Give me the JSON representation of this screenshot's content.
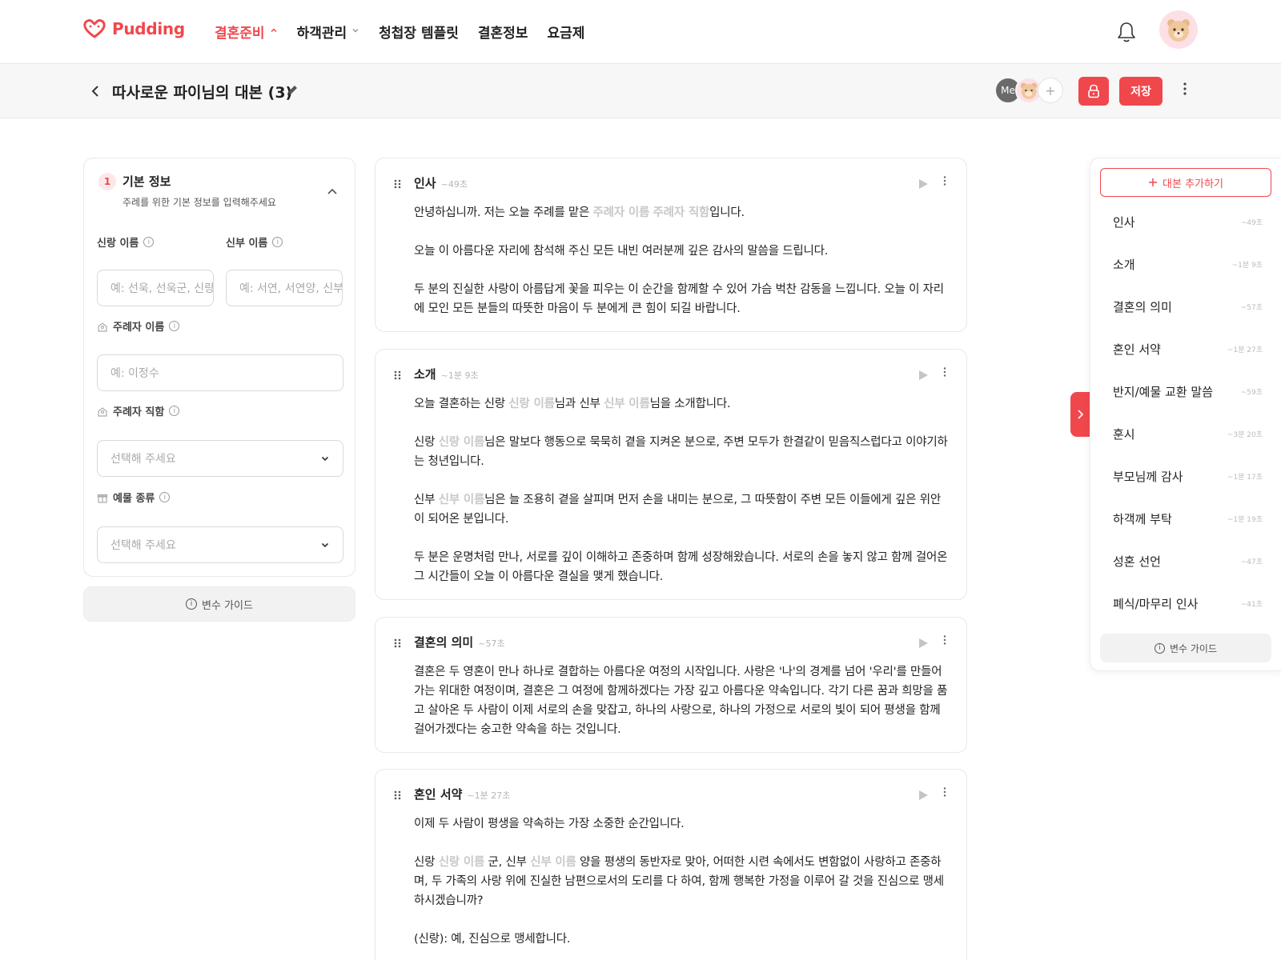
{
  "brand": {
    "name": "Pudding",
    "accent": "#f0474d"
  },
  "nav": {
    "items": [
      {
        "label": "결혼준비",
        "active": true,
        "chevron": "^"
      },
      {
        "label": "하객관리",
        "active": false,
        "chevron": "⌄"
      },
      {
        "label": "청첩장 템플릿",
        "active": false
      },
      {
        "label": "결혼정보",
        "active": false
      },
      {
        "label": "요금제",
        "active": false
      }
    ]
  },
  "header": {
    "title": "따사로운 파이님의 대본 (3)",
    "collaborator_me": "Me",
    "save_label": "저장"
  },
  "form": {
    "step_number": "1",
    "step_title": "기본 정보",
    "step_subtitle": "주례를 위한 기본 정보를 입력해주세요",
    "groom_label": "신랑 이름",
    "groom_placeholder": "예: 선욱, 선욱군, 신랑",
    "bride_label": "신부 이름",
    "bride_placeholder": "예: 서연, 서연양, 신부",
    "officiant_label": "주례자 이름",
    "officiant_placeholder": "예: 이정수",
    "officiant_title_label": "주례자 직함",
    "officiant_title_placeholder": "선택해 주세요",
    "gift_label": "예물 종류",
    "gift_placeholder": "선택해 주세요",
    "guide_label": "변수 가이드"
  },
  "cards": [
    {
      "title": "인사",
      "duration": "~49초",
      "paragraphs": [
        [
          {
            "t": "안녕하십니까. 저는 오늘 주례를 맡은 "
          },
          {
            "t": "주례자 이름",
            "v": true
          },
          {
            "t": " "
          },
          {
            "t": "주례자 직함",
            "v": true
          },
          {
            "t": "입니다."
          }
        ],
        [
          {
            "t": "오늘 이 아름다운 자리에 참석해 주신 모든 내빈 여러분께 깊은 감사의 말씀을 드립니다."
          }
        ],
        [
          {
            "t": "두 분의 진실한 사랑이 아름답게 꽃을 피우는 이 순간을 함께할 수 있어 가슴 벅찬 감동을 느낍니다. 오늘 이 자리에 모인 모든 분들의 따뜻한 마음이 두 분에게 큰 힘이 되길 바랍니다."
          }
        ]
      ]
    },
    {
      "title": "소개",
      "duration": "~1분 9초",
      "paragraphs": [
        [
          {
            "t": "오늘 결혼하는 신랑 "
          },
          {
            "t": "신랑 이름",
            "v": true
          },
          {
            "t": "님과 신부 "
          },
          {
            "t": "신부 이름",
            "v": true
          },
          {
            "t": "님을 소개합니다."
          }
        ],
        [
          {
            "t": "신랑 "
          },
          {
            "t": "신랑 이름",
            "v": true
          },
          {
            "t": "님은 말보다 행동으로 묵묵히 곁을 지켜온 분으로, 주변 모두가 한결같이 믿음직스럽다고 이야기하는 청년입니다."
          }
        ],
        [
          {
            "t": "신부 "
          },
          {
            "t": "신부 이름",
            "v": true
          },
          {
            "t": "님은 늘 조용히 곁을 살피며 먼저 손을 내미는 분으로, 그 따뜻함이 주변 모든 이들에게 깊은 위안이 되어온 분입니다."
          }
        ],
        [
          {
            "t": "두 분은 운명처럼 만나, 서로를 깊이 이해하고 존중하며 함께 성장해왔습니다. 서로의 손을 놓지 않고 함께 걸어온 그 시간들이 오늘 이 아름다운 결실을 맺게 했습니다."
          }
        ]
      ]
    },
    {
      "title": "결혼의 의미",
      "duration": "~57초",
      "paragraphs": [
        [
          {
            "t": "결혼은 두 영혼이 만나 하나로 결합하는 아름다운 여정의 시작입니다. 사랑은 '나'의 경계를 넘어 '우리'를 만들어가는 위대한 여정이며, 결혼은 그 여정에 함께하겠다는 가장 깊고 아름다운 약속입니다. 각기 다른 꿈과 희망을 품고 살아온 두 사람이 이제 서로의 손을 맞잡고, 하나의 사랑으로, 하나의 가정으로 서로의 빛이 되어 평생을 함께 걸어가겠다는 숭고한 약속을 하는 것입니다."
          }
        ]
      ]
    },
    {
      "title": "혼인 서약",
      "duration": "~1분 27초",
      "paragraphs": [
        [
          {
            "t": "이제 두 사람이 평생을 약속하는 가장 소중한 순간입니다."
          }
        ],
        [
          {
            "t": "신랑 "
          },
          {
            "t": "신랑 이름",
            "v": true
          },
          {
            "t": " 군, 신부 "
          },
          {
            "t": "신부 이름",
            "v": true
          },
          {
            "t": " 양을 평생의 동반자로 맞아, 어떠한 시련 속에서도 변함없이 사랑하고 존중하며, 두 가족의 사랑 위에 진실한 남편으로서의 도리를 다 하여, 함께 행복한 가정을 이루어 갈 것을 진심으로 맹세하시겠습니까?"
          }
        ],
        [
          {
            "t": "(신랑): 예, 진심으로 맹세합니다."
          }
        ]
      ]
    }
  ],
  "toc": {
    "add_label": "대본 추가하기",
    "items": [
      {
        "label": "인사",
        "duration": "~49초"
      },
      {
        "label": "소개",
        "duration": "~1분 9초"
      },
      {
        "label": "결혼의 의미",
        "duration": "~57초"
      },
      {
        "label": "혼인 서약",
        "duration": "~1분 27초"
      },
      {
        "label": "반지/예물 교환 말씀",
        "duration": "~59초"
      },
      {
        "label": "훈시",
        "duration": "~3분 20초"
      },
      {
        "label": "부모님께 감사",
        "duration": "~1분 17초"
      },
      {
        "label": "하객께 부탁",
        "duration": "~1분 19초"
      },
      {
        "label": "성혼 선언",
        "duration": "~47초"
      },
      {
        "label": "폐식/마무리 인사",
        "duration": "~41초"
      }
    ],
    "guide_label": "변수 가이드"
  }
}
